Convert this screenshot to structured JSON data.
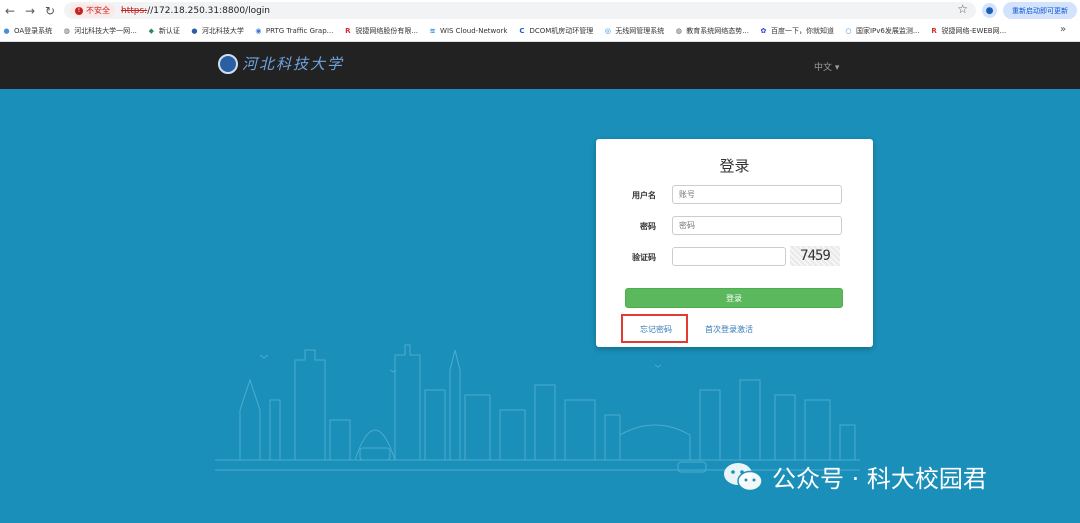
{
  "browser": {
    "insecure_label": "不安全",
    "url_scheme": "https:",
    "url_rest": "//172.18.250.31:8800/login",
    "update_label": "重新启动即可更新",
    "bookmarks": [
      {
        "label": "OA登录系统",
        "icon": "oa-icon"
      },
      {
        "label": "河北科技大学一网...",
        "icon": "globe-icon"
      },
      {
        "label": "新认证",
        "icon": "diamond-icon"
      },
      {
        "label": "河北科技大学",
        "icon": "emblem-icon"
      },
      {
        "label": "PRTG Traffic Grap...",
        "icon": "prtg-icon"
      },
      {
        "label": "锐捷网络股份有限...",
        "icon": "ruijie-icon"
      },
      {
        "label": "WIS Cloud-Network",
        "icon": "wis-icon"
      },
      {
        "label": "DCOM机房动环管理",
        "icon": "dcom-icon"
      },
      {
        "label": "无线网管理系统",
        "icon": "wireless-icon"
      },
      {
        "label": "教育系统网络态势...",
        "icon": "globe-icon"
      },
      {
        "label": "百度一下，你就知道",
        "icon": "baidu-icon"
      },
      {
        "label": "国家IPv6发展监测...",
        "icon": "ipv6-icon"
      },
      {
        "label": "锐捷网络-EWEB网...",
        "icon": "ruijie-icon"
      }
    ]
  },
  "header": {
    "school_name": "河北科技大学",
    "language": "中文 ▾"
  },
  "login": {
    "title": "登录",
    "username_label": "用户名",
    "username_placeholder": "账号",
    "password_label": "密码",
    "password_placeholder": "密码",
    "captcha_label": "验证码",
    "captcha_value": "",
    "captcha_text": "7459",
    "submit_label": "登录",
    "forgot_label": "忘记密码",
    "activate_label": "首次登录激活"
  },
  "watermark": {
    "text": "公众号 · 科大校园君"
  }
}
